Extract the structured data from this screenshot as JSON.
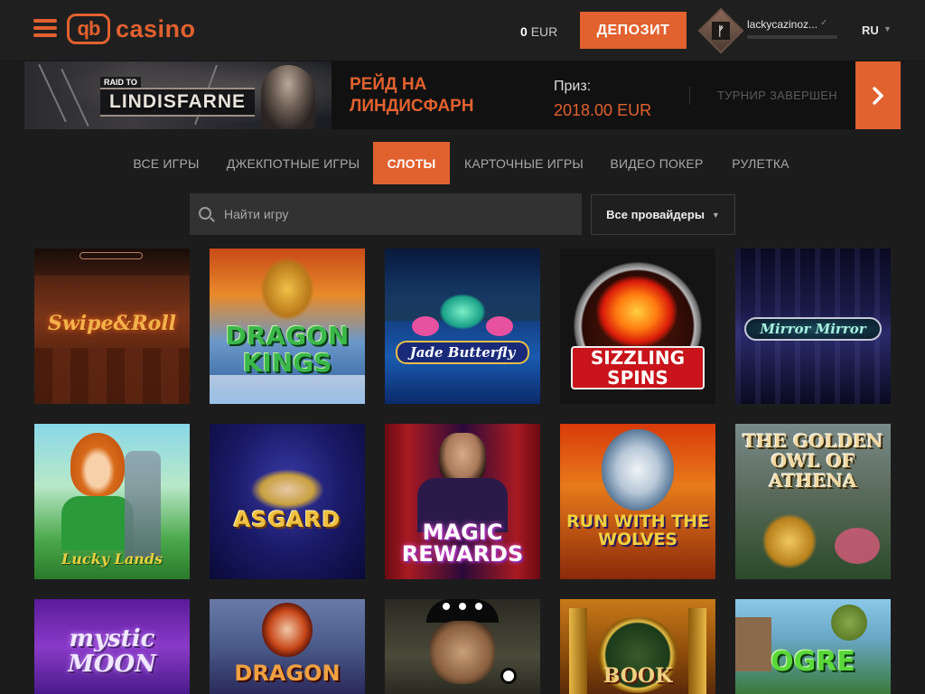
{
  "header": {
    "logo_mark": "qb",
    "logo_text": "casino",
    "balance_amount": "0",
    "balance_currency": "EUR",
    "deposit_label": "ДЕПОЗИТ",
    "avatar_letter": "ᚠ",
    "username": "lackycazinoz...",
    "level_progress": 0,
    "language": "RU"
  },
  "banner": {
    "raid_small": "RAID TO",
    "raid_big": "LINDISFARNE",
    "title": "РЕЙД НА ЛИНДИСФАРН",
    "prize_label": "Приз:",
    "prize_value": "2018.00 EUR",
    "status": "ТУРНИР ЗАВЕРШЕН"
  },
  "tabs": [
    {
      "label": "ВСЕ ИГРЫ"
    },
    {
      "label": "ДЖЕКПОТНЫЕ ИГРЫ"
    },
    {
      "label": "СЛОТЫ"
    },
    {
      "label": "КАРТОЧНЫЕ ИГРЫ"
    },
    {
      "label": "ВИДЕО ПОКЕР"
    },
    {
      "label": "РУЛЕТКА"
    }
  ],
  "active_tab": "СЛОТЫ",
  "search": {
    "placeholder": "Найти игру"
  },
  "provider": {
    "label": "Все провайдеры"
  },
  "colors": {
    "accent": "#e1612f",
    "background": "#1c1c1c"
  },
  "games": [
    {
      "title": "Swipe&Roll"
    },
    {
      "title": "DRAGON KINGS"
    },
    {
      "title": "Jade Butterfly"
    },
    {
      "title": "SIZZLING SPINS"
    },
    {
      "title": "Mirror Mirror"
    },
    {
      "title": "Lucky Lands"
    },
    {
      "title": "ASGARD"
    },
    {
      "title": "MAGIC REWARDS"
    },
    {
      "title": "RUN WITH THE WOLVES"
    },
    {
      "title": "THE GOLDEN OWL OF ATHENA"
    },
    {
      "title": "mystic MOON"
    },
    {
      "title": "DRAGON"
    },
    {
      "title": ""
    },
    {
      "title": "BOOK"
    },
    {
      "title": "OGRE"
    }
  ]
}
